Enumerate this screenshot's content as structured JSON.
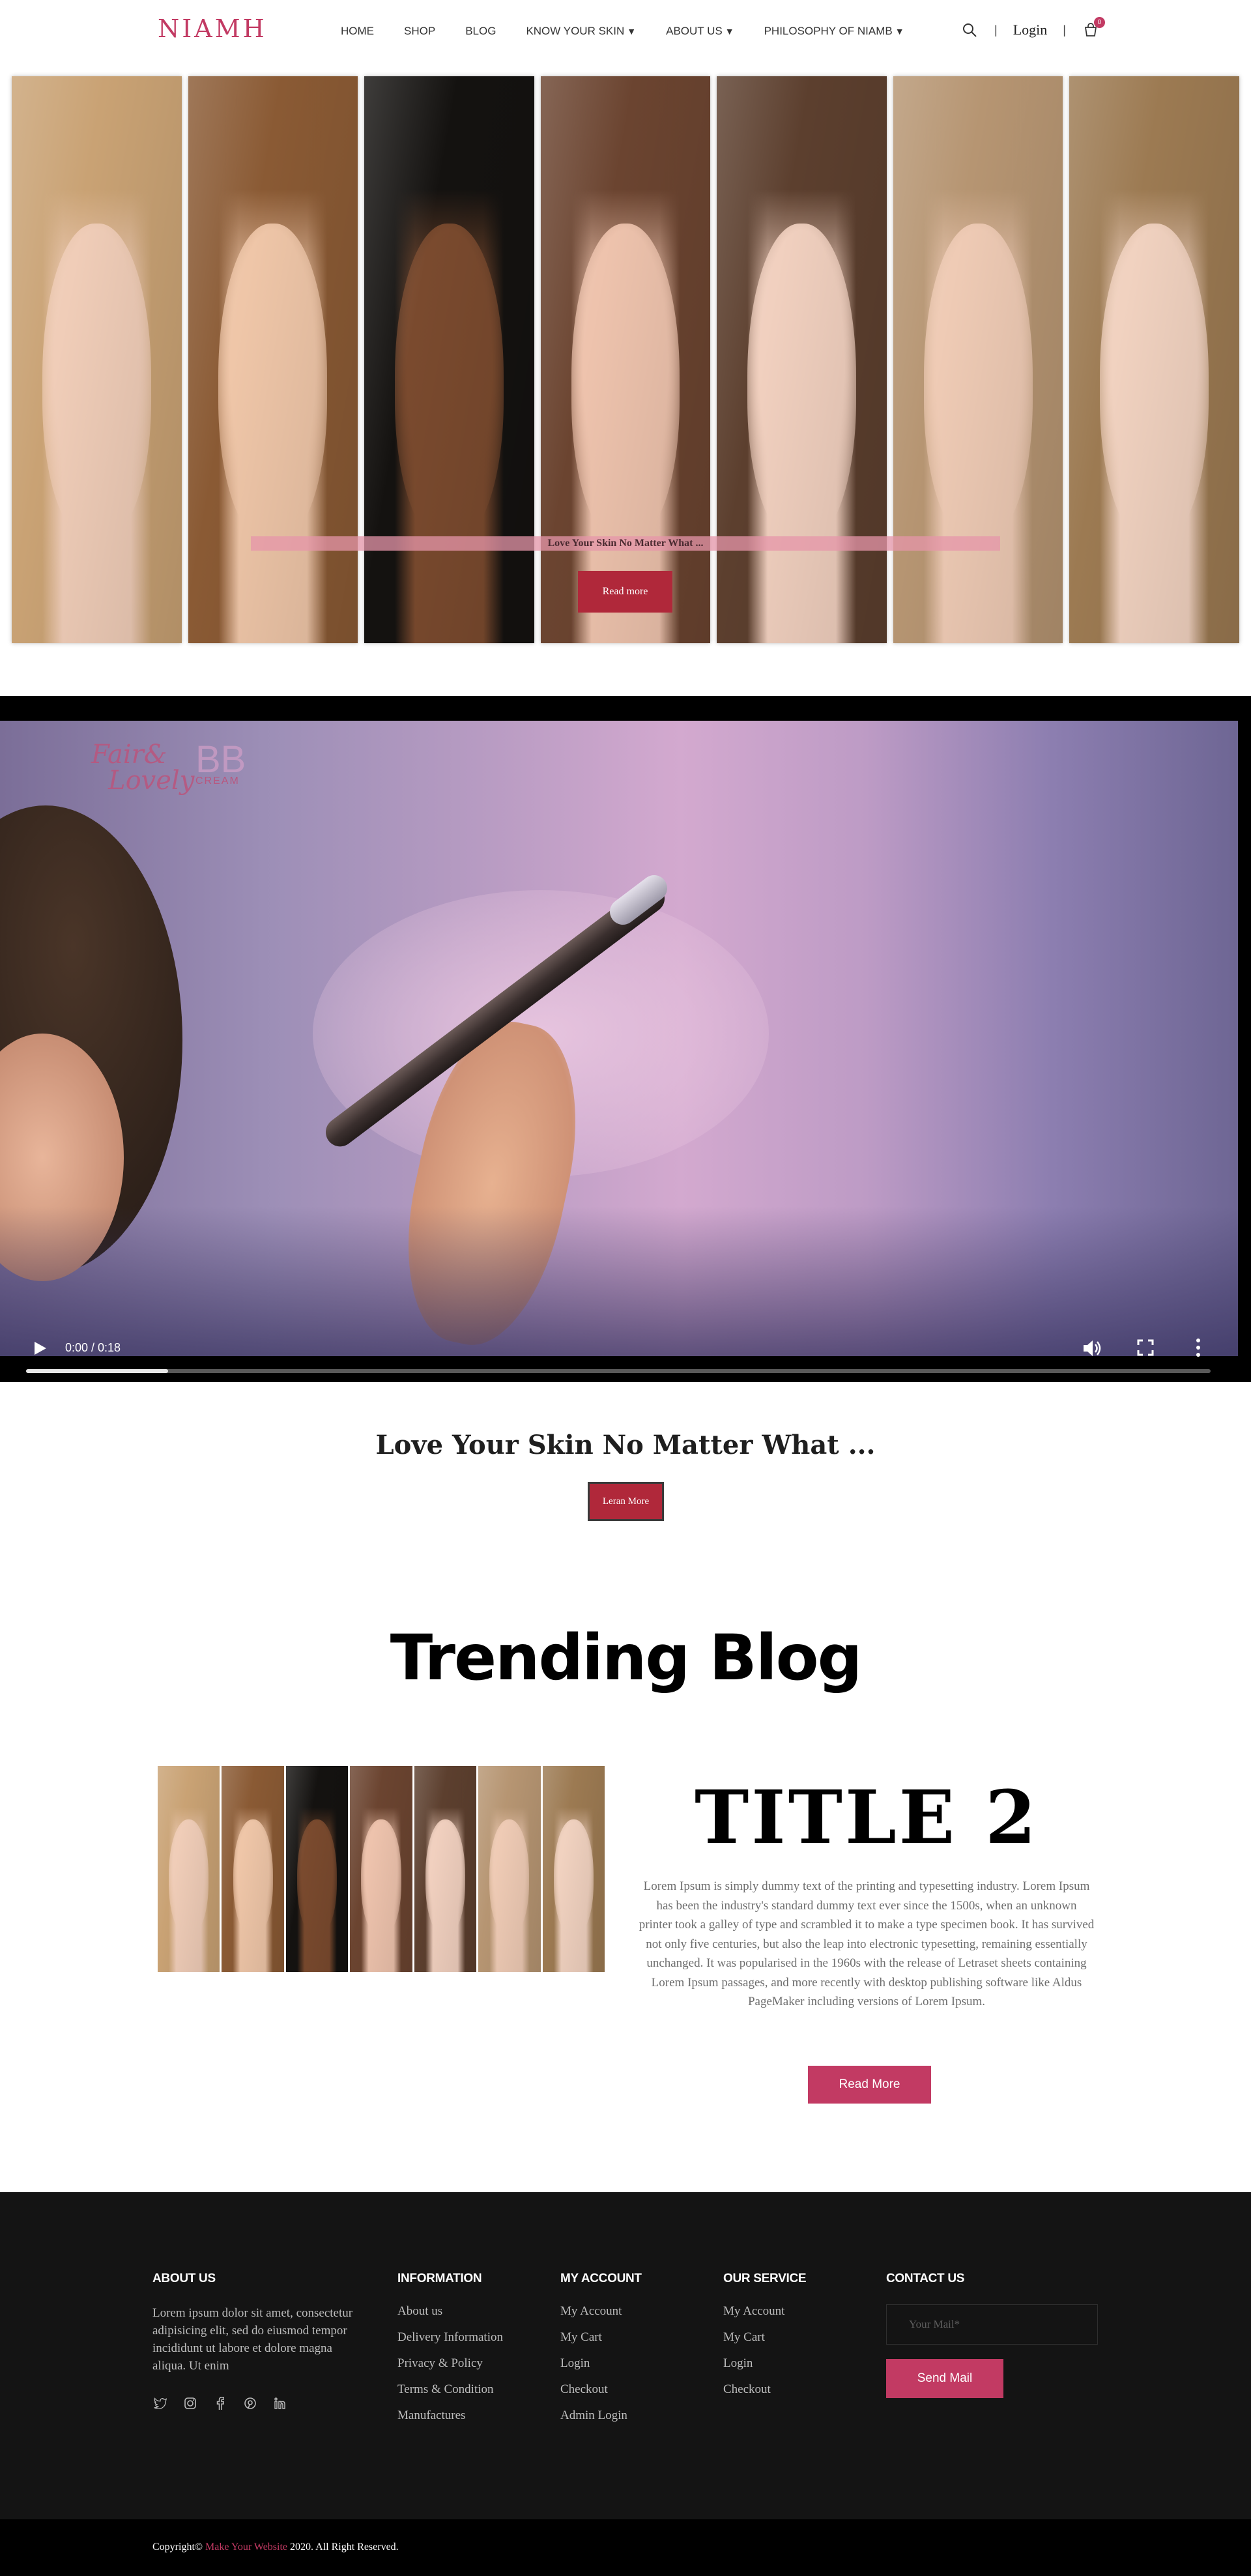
{
  "header": {
    "logo": "NIAMH",
    "nav": [
      {
        "label": "HOME",
        "dropdown": false
      },
      {
        "label": "SHOP",
        "dropdown": false
      },
      {
        "label": "BLOG",
        "dropdown": false
      },
      {
        "label": "KNOW YOUR SKIN",
        "dropdown": true
      },
      {
        "label": "ABOUT US",
        "dropdown": true
      },
      {
        "label": "PHILOSOPHY OF NIAMB",
        "dropdown": true
      }
    ],
    "separator": "|",
    "login_label": "Login",
    "cart_count": "0",
    "icons": {
      "search": "search-icon",
      "cart": "cart-icon",
      "dropdown": "caret-down-icon"
    }
  },
  "hero": {
    "caption": "Love Your Skin No Matter What ...",
    "button_label": "Read more",
    "panels": [
      {
        "hair": "#c9a274",
        "skin": "#f0cdb8"
      },
      {
        "hair": "#8a5a34",
        "skin": "#efc6a8"
      },
      {
        "hair": "#141210",
        "skin": "#7a4a2e"
      },
      {
        "hair": "#6b4430",
        "skin": "#eec3ad"
      },
      {
        "hair": "#5c3f2e",
        "skin": "#f1d0bf"
      },
      {
        "hair": "#b69572",
        "skin": "#efcbb5"
      },
      {
        "hair": "#9c7a52",
        "skin": "#f1d2c0"
      }
    ]
  },
  "video": {
    "brand_line1": "Fair&",
    "brand_line2": "Lovely",
    "brand_bb": "BB",
    "brand_bb_sub": "CREAM",
    "time": "0:00 / 0:18",
    "progress": 0.12,
    "icons": {
      "play": "play-icon",
      "volume": "volume-icon",
      "fullscreen": "fullscreen-icon",
      "more": "more-vertical-icon"
    }
  },
  "tagline": {
    "text": "Love Your Skin No Matter What ...",
    "button_label": "Leran More"
  },
  "blog": {
    "section_title": "Trending Blog",
    "post_title": "TITLE 2",
    "post_text": "Lorem Ipsum is simply dummy text of the printing and typesetting industry. Lorem Ipsum has been the industry's standard dummy text ever since the 1500s, when an unknown printer took a galley of type and scrambled it to make a type specimen book. It has survived not only five centuries, but also the leap into electronic typesetting, remaining essentially unchanged. It was popularised in the 1960s with the release of Letraset sheets containing Lorem Ipsum passages, and more recently with desktop publishing software like Aldus PageMaker including versions of Lorem Ipsum.",
    "button_label": "Read More"
  },
  "footer": {
    "about": {
      "heading": "ABOUT US",
      "text": "Lorem ipsum dolor sit amet, consectetur adipisicing elit, sed do eiusmod tempor incididunt ut labore et dolore magna aliqua. Ut enim",
      "social_icons": [
        "twitter-icon",
        "instagram-icon",
        "facebook-icon",
        "pinterest-icon",
        "linkedin-icon"
      ]
    },
    "information": {
      "heading": "INFORMATION",
      "links": [
        "About us",
        "Delivery Information",
        "Privacy & Policy",
        "Terms & Condition",
        "Manufactures"
      ]
    },
    "account": {
      "heading": "MY ACCOUNT",
      "links": [
        "My Account",
        "My Cart",
        "Login",
        "Checkout",
        "Admin Login"
      ]
    },
    "service": {
      "heading": "OUR SERVICE",
      "links": [
        "My Account",
        "My Cart",
        "Login",
        "Checkout"
      ]
    },
    "contact": {
      "heading": "CONTACT US",
      "mail_placeholder": "Your Mail*",
      "send_label": "Send Mail"
    },
    "copyright_prefix": "Copyright©",
    "copyright_link": "Make Your Website",
    "copyright_suffix": "2020. All Right Reserved."
  },
  "colors": {
    "accent": "#c23a63",
    "button_red": "#b0283a",
    "footer_bg": "#141414"
  }
}
